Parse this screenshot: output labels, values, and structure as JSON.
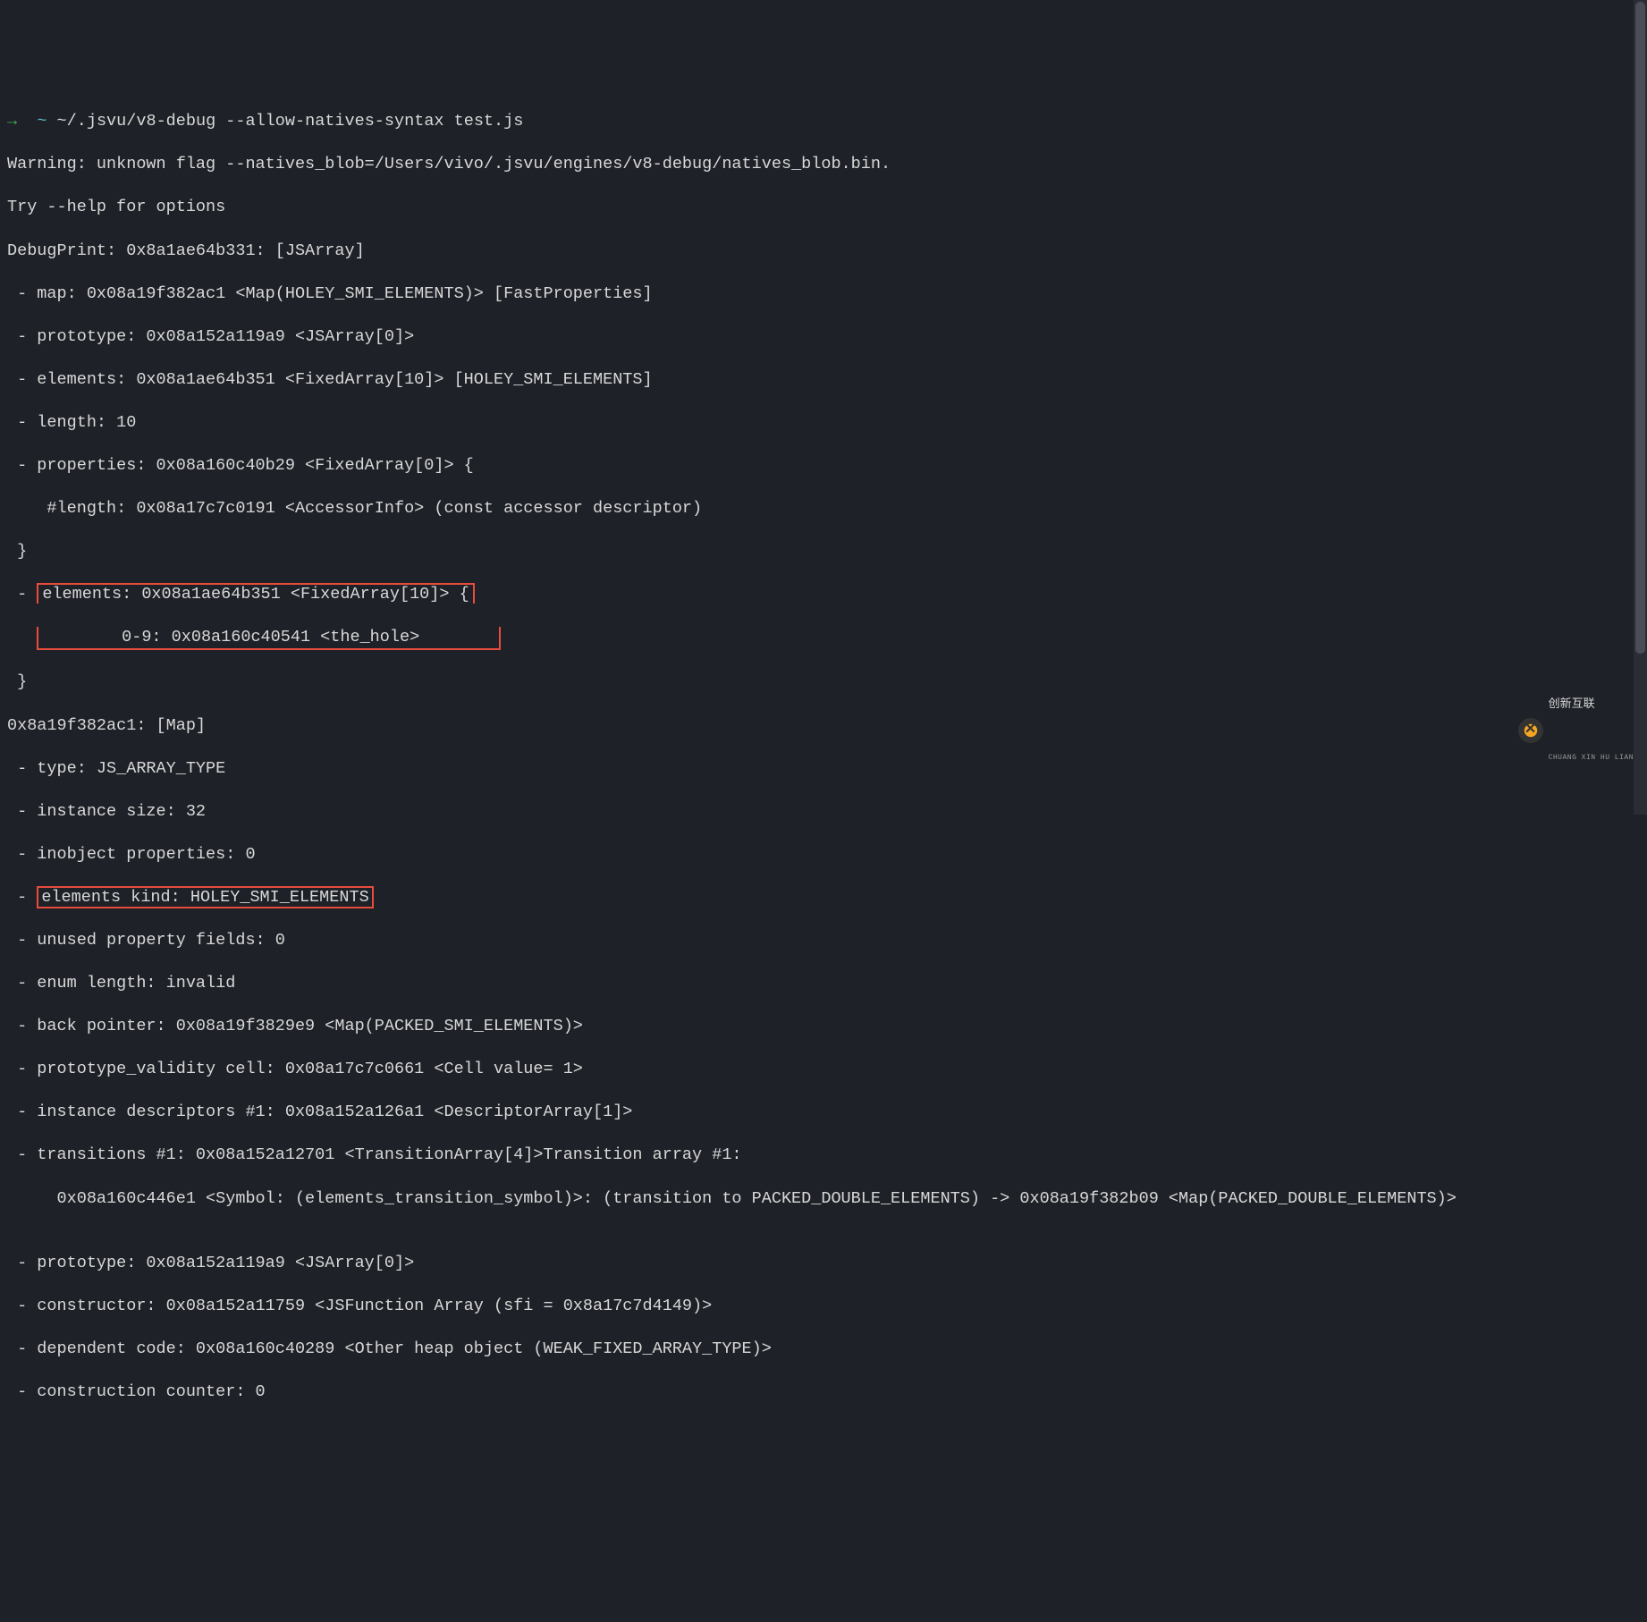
{
  "prompt": {
    "arrow": "→",
    "tilde": "~",
    "command": "~/.jsvu/v8-debug --allow-natives-syntax test.js"
  },
  "lines": [
    "Warning: unknown flag --natives_blob=/Users/vivo/.jsvu/engines/v8-debug/natives_blob.bin.",
    "Try --help for options",
    "DebugPrint: 0x8a1ae64b331: [JSArray]",
    " - map: 0x08a19f382ac1 <Map(HOLEY_SMI_ELEMENTS)> [FastProperties]",
    " - prototype: 0x08a152a119a9 <JSArray[0]>",
    " - elements: 0x08a1ae64b351 <FixedArray[10]> [HOLEY_SMI_ELEMENTS]",
    " - length: 10",
    " - properties: 0x08a160c40b29 <FixedArray[0]> {",
    "    #length: 0x08a17c7c0191 <AccessorInfo> (const accessor descriptor)",
    " }"
  ],
  "box1_lines": {
    "prefix": " - ",
    "line1": "elements: 0x08a1ae64b351 <FixedArray[10]> {",
    "line2": "        0-9: 0x08a160c40541 <the_hole>"
  },
  "post_box1": " }",
  "mid_lines": [
    "0x8a19f382ac1: [Map]",
    " - type: JS_ARRAY_TYPE",
    " - instance size: 32",
    " - inobject properties: 0"
  ],
  "box2_line": {
    "prefix": " - ",
    "content": "elements kind: HOLEY_SMI_ELEMENTS"
  },
  "end_lines": [
    " - unused property fields: 0",
    " - enum length: invalid",
    " - back pointer: 0x08a19f3829e9 <Map(PACKED_SMI_ELEMENTS)>",
    " - prototype_validity cell: 0x08a17c7c0661 <Cell value= 1>",
    " - instance descriptors #1: 0x08a152a126a1 <DescriptorArray[1]>",
    " - transitions #1: 0x08a152a12701 <TransitionArray[4]>Transition array #1:",
    "     0x08a160c446e1 <Symbol: (elements_transition_symbol)>: (transition to PACKED_DOUBLE_ELEMENTS) -> 0x08a19f382b09 <Map(PACKED_DOUBLE_ELEMENTS)>",
    "",
    " - prototype: 0x08a152a119a9 <JSArray[0]>",
    " - constructor: 0x08a152a11759 <JSFunction Array (sfi = 0x8a17c7d4149)>",
    " - dependent code: 0x08a160c40289 <Other heap object (WEAK_FIXED_ARRAY_TYPE)>",
    " - construction counter: 0"
  ],
  "logo": {
    "main": "创新互联",
    "sub": "CHUANG XIN HU LIAN"
  }
}
